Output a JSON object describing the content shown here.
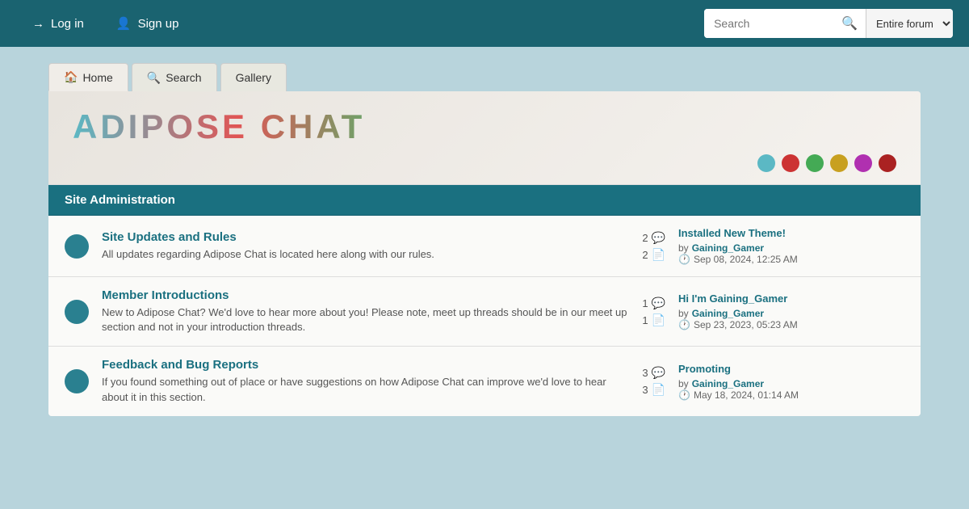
{
  "topnav": {
    "login_label": "Log in",
    "signup_label": "Sign up",
    "search_placeholder": "Search",
    "search_scope": "Entire forum"
  },
  "subnav": {
    "tabs": [
      {
        "label": "Home",
        "icon": "🏠",
        "active": true
      },
      {
        "label": "Search",
        "icon": "🔍",
        "active": false
      },
      {
        "label": "Gallery",
        "icon": "",
        "active": false
      }
    ]
  },
  "banner": {
    "title": "ADIPOSE CHAT",
    "dots": [
      {
        "color": "#5bb8c4"
      },
      {
        "color": "#cc3333"
      },
      {
        "color": "#44aa55"
      },
      {
        "color": "#c8a020"
      },
      {
        "color": "#b030b0"
      },
      {
        "color": "#aa2222"
      }
    ]
  },
  "sections": [
    {
      "title": "Site Administration",
      "forums": [
        {
          "title": "Site Updates and Rules",
          "description": "All updates regarding Adipose Chat is located here along with our rules.",
          "posts": 2,
          "threads": 2,
          "last_post_title": "Installed New Theme!",
          "last_post_by": "by",
          "last_post_author": "Gaining_Gamer",
          "last_post_date": "Sep 08, 2024, 12:25 AM"
        },
        {
          "title": "Member Introductions",
          "description": "New to Adipose Chat? We'd love to hear more about you! Please note, meet up threads should be in our meet up section and not in your introduction threads.",
          "posts": 1,
          "threads": 1,
          "last_post_title": "Hi I'm Gaining_Gamer",
          "last_post_by": "by",
          "last_post_author": "Gaining_Gamer",
          "last_post_date": "Sep 23, 2023, 05:23 AM"
        },
        {
          "title": "Feedback and Bug Reports",
          "description": "If you found something out of place or have suggestions on how Adipose Chat can improve we'd love to hear about it in this section.",
          "posts": 3,
          "threads": 3,
          "last_post_title": "Promoting",
          "last_post_by": "by",
          "last_post_author": "Gaining_Gamer",
          "last_post_date": "May 18, 2024, 01:14 AM"
        }
      ]
    }
  ]
}
